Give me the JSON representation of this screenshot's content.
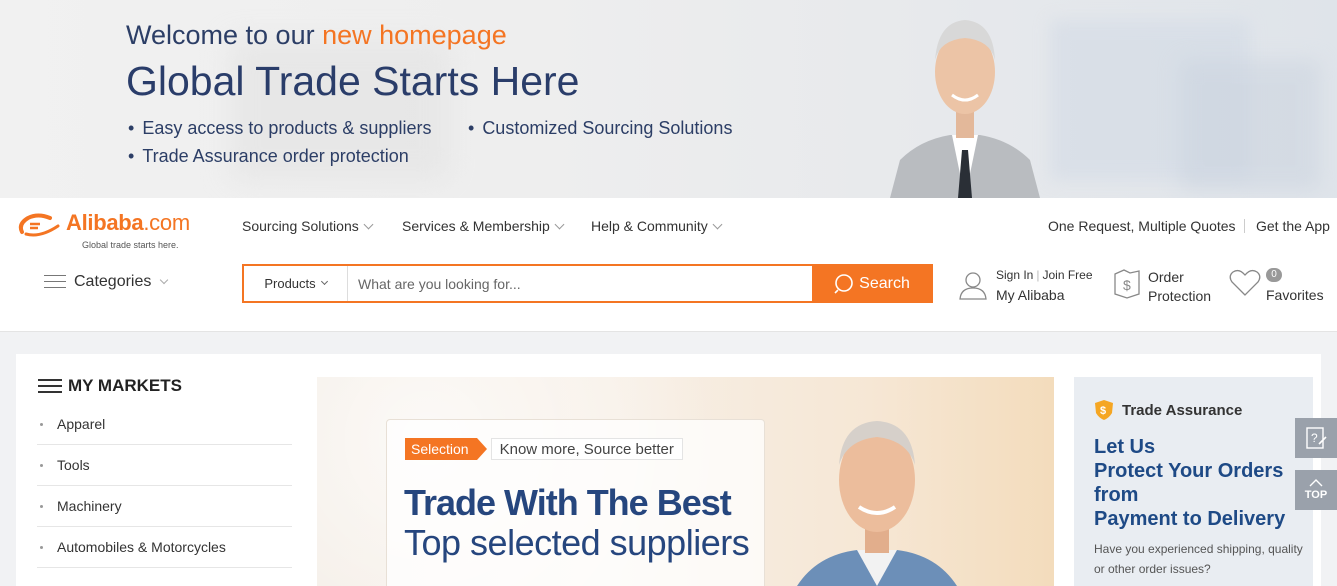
{
  "banner": {
    "welcome_prefix": "Welcome to our",
    "welcome_highlight": "new homepage",
    "title": "Global Trade Starts Here",
    "bullets": [
      "Easy access to products & suppliers",
      "Customized Sourcing Solutions",
      "Trade Assurance order protection"
    ]
  },
  "header": {
    "logo": {
      "name": "Alibaba",
      "suffix": ".com",
      "tagline": "Global trade starts here."
    },
    "nav": [
      "Sourcing Solutions",
      "Services & Membership",
      "Help & Community"
    ],
    "top_links": [
      "One Request, Multiple Quotes",
      "Get the App"
    ],
    "categories_label": "Categories",
    "search": {
      "category": "Products",
      "placeholder": "What are you looking for...",
      "button": "Search"
    },
    "account": {
      "sign_in": "Sign In",
      "join": "Join Free",
      "my": "My Alibaba"
    },
    "order": {
      "line1": "Order",
      "line2": "Protection"
    },
    "favorites": {
      "count": "0",
      "label": "Favorites"
    }
  },
  "markets": {
    "title": "MY MARKETS",
    "items": [
      "Apparel",
      "Tools",
      "Machinery",
      "Automobiles & Motorcycles"
    ]
  },
  "hero": {
    "tag": "Selection",
    "tag_text": "Know more, Source better",
    "title": "Trade With The Best",
    "subtitle": "Top selected suppliers"
  },
  "trade_assurance": {
    "header": "Trade Assurance",
    "title_lines": [
      "Let Us",
      "Protect Your Orders",
      "from",
      "Payment to Delivery"
    ],
    "desc": "Have you experienced shipping, quality or other order issues?"
  },
  "side": {
    "top_label": "TOP"
  },
  "colors": {
    "accent": "#f47523",
    "navy": "#26467e"
  }
}
